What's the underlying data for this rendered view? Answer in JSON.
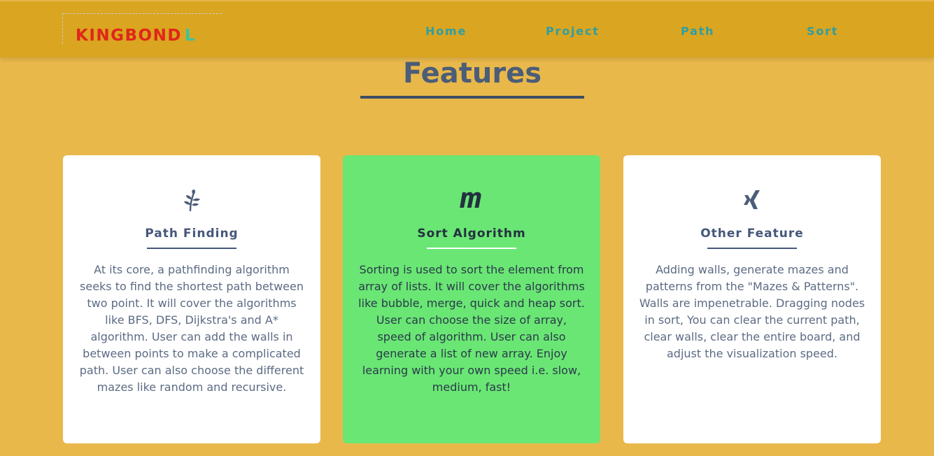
{
  "header": {
    "brand": "KINGBOND",
    "brand_mark": "L",
    "nav": [
      "Home",
      "Project",
      "Path",
      "Sort"
    ]
  },
  "section": {
    "title": "Features"
  },
  "cards": [
    {
      "icon": "leaf-sprig-icon",
      "title": "Path Finding",
      "description": "At its core, a pathfinding algorithm seeks to find the shortest path between two point. It will cover the algorithms like BFS, DFS, Dijkstra's and A* algorithm. User can add the walls in between points to make a complicated path. User can also choose the different mazes like random and recursive."
    },
    {
      "icon": "m-logo-icon",
      "title": "Sort Algorithm",
      "description": "Sorting is used to sort the element from array of lists. It will cover the algorithms like bubble, merge, quick and heap sort. User can choose the size of array, speed of algorithm. User can also generate a list of new array. Enjoy learning with your own speed i.e. slow, medium, fast!"
    },
    {
      "icon": "xing-icon",
      "title": "Other Feature",
      "description": "Adding walls, generate mazes and patterns from the \"Mazes & Patterns\". Walls are impenetrable. Dragging nodes in sort, You can clear the current path, clear walls, clear the entire board, and adjust the visualization speed."
    }
  ],
  "colors": {
    "page_background": "#e9b84a",
    "navbar": "#daa520",
    "brand": "#e0261a",
    "brand_mark": "#3cc3a0",
    "nav_link": "#2e9ea3",
    "heading": "#4b5d78",
    "active_card": "#6ae674"
  }
}
